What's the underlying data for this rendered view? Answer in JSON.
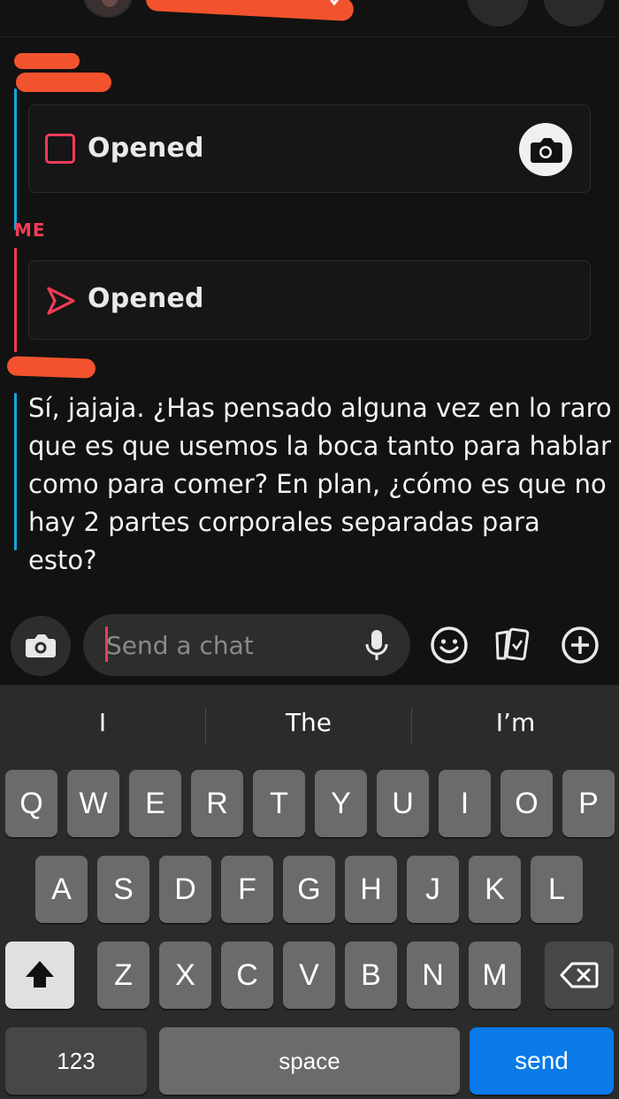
{
  "header": {
    "back_icon": "chevron-left-icon",
    "redaction_color": "#f2532e"
  },
  "messages": [
    {
      "sender": "",
      "type": "snap",
      "status": "Opened",
      "icon": "square-snap-icon",
      "accent": "#11a7e0"
    },
    {
      "sender": "ME",
      "type": "snap",
      "status": "Opened",
      "icon": "arrow-sent-icon",
      "accent": "#f23c57"
    },
    {
      "sender": "",
      "type": "text",
      "text": "Sí, jajaja. ¿Has pensado alguna vez en lo raro que es que usemos la boca tanto para hablar como para comer? En plan, ¿cómo es que no hay 2 partes corporales separadas para esto?",
      "accent": "#11a7e0"
    }
  ],
  "input": {
    "placeholder": "Send a chat"
  },
  "keyboard": {
    "suggestions": [
      "I",
      "The",
      "I’m"
    ],
    "row1": [
      "Q",
      "W",
      "E",
      "R",
      "T",
      "Y",
      "U",
      "I",
      "O",
      "P"
    ],
    "row2": [
      "A",
      "S",
      "D",
      "F",
      "G",
      "H",
      "J",
      "K",
      "L"
    ],
    "row3": [
      "Z",
      "X",
      "C",
      "V",
      "B",
      "N",
      "M"
    ],
    "numbers_label": "123",
    "space_label": "space",
    "send_label": "send"
  }
}
